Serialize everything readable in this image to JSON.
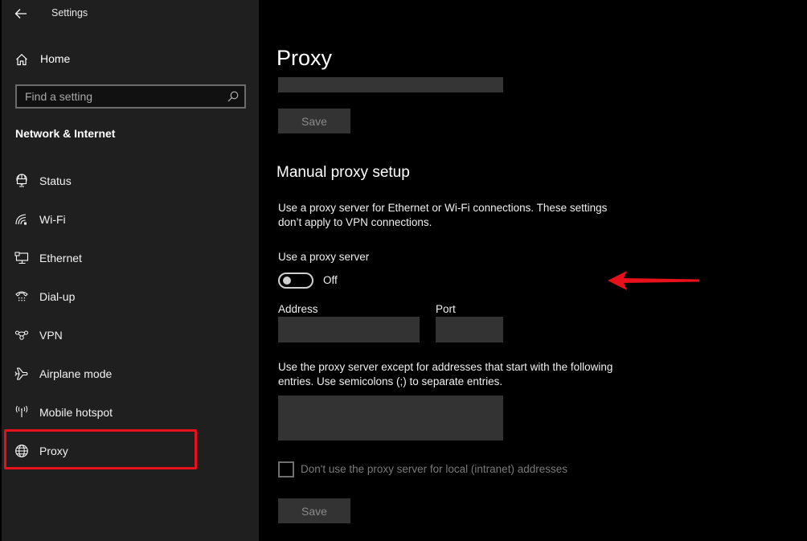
{
  "window": {
    "app_title": "Settings",
    "back_icon": "arrow-left-icon"
  },
  "sidebar": {
    "home": {
      "label": "Home",
      "icon": "home-icon"
    },
    "search": {
      "placeholder": "Find a setting",
      "value": "",
      "icon": "search-icon"
    },
    "section_title": "Network & Internet",
    "items": [
      {
        "label": "Status",
        "icon": "globe-monitor-icon",
        "selected": false
      },
      {
        "label": "Wi-Fi",
        "icon": "wifi-icon",
        "selected": false
      },
      {
        "label": "Ethernet",
        "icon": "ethernet-icon",
        "selected": false
      },
      {
        "label": "Dial-up",
        "icon": "phone-icon",
        "selected": false
      },
      {
        "label": "VPN",
        "icon": "vpn-icon",
        "selected": false
      },
      {
        "label": "Airplane mode",
        "icon": "airplane-icon",
        "selected": false
      },
      {
        "label": "Mobile hotspot",
        "icon": "hotspot-icon",
        "selected": false
      },
      {
        "label": "Proxy",
        "icon": "globe-icon",
        "selected": true
      }
    ],
    "highlight_color": "#e8101b"
  },
  "main": {
    "page_title": "Proxy",
    "script_address_value": "",
    "save_label": "Save",
    "manual_section_title": "Manual proxy setup",
    "manual_description": "Use a proxy server for Ethernet or Wi-Fi connections. These settings don’t apply to VPN connections.",
    "use_proxy_label": "Use a proxy server",
    "use_proxy_toggle": {
      "state": "Off",
      "on": false
    },
    "address_label": "Address",
    "address_value": "",
    "port_label": "Port",
    "port_value": "",
    "exceptions_description": "Use the proxy server except for addresses that start with the following entries. Use semicolons (;) to separate entries.",
    "exceptions_value": "",
    "local_bypass": {
      "label": "Don't use the proxy server for local (intranet) addresses",
      "checked": false
    },
    "save2_label": "Save",
    "annotation_arrow_color": "#e8101b"
  }
}
